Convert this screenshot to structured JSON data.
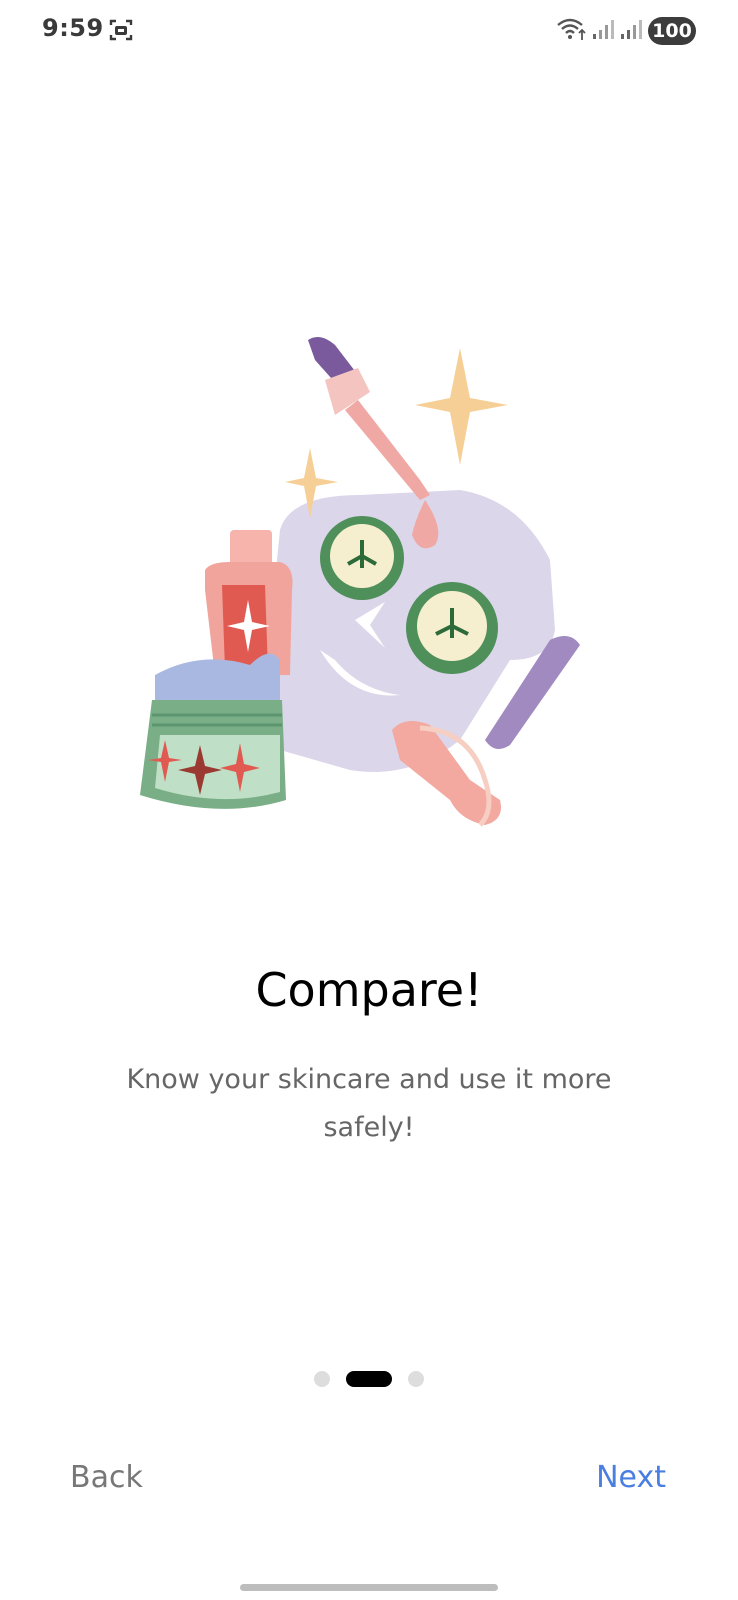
{
  "status_bar": {
    "time": "9:59",
    "battery": "100",
    "icons": [
      "screenshot-icon",
      "wifi-icon",
      "signal-icon",
      "signal-icon"
    ]
  },
  "onboarding": {
    "title": "Compare!",
    "description": "Know your skincare and use it more safely!",
    "page_count": 3,
    "active_page": 2
  },
  "nav": {
    "back_label": "Back",
    "next_label": "Next"
  },
  "colors": {
    "accent": "#4a7ee0",
    "title": "#000000",
    "subtitle": "#666666",
    "dot_inactive": "#dddddd",
    "dot_active": "#000000"
  }
}
